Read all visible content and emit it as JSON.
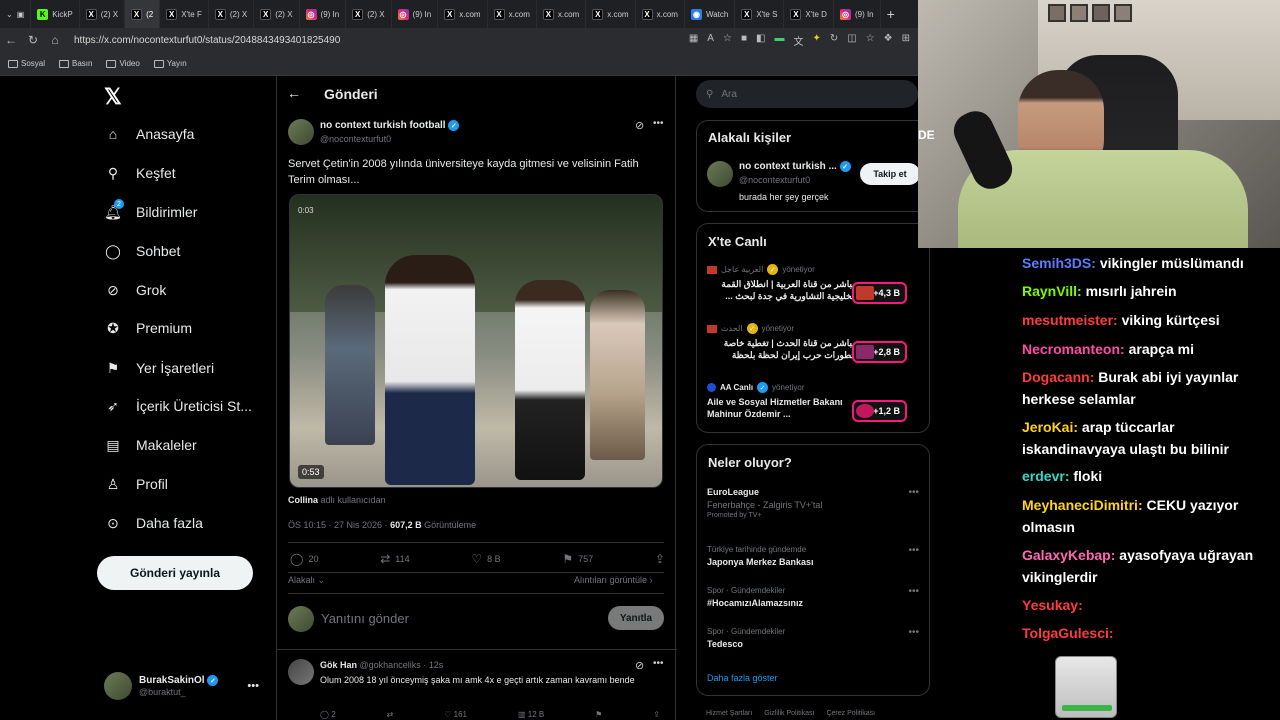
{
  "browser": {
    "tabs": [
      {
        "icon": "kick",
        "label": "KickP"
      },
      {
        "icon": "x",
        "label": "(2) X"
      },
      {
        "icon": "x",
        "label": "(2"
      },
      {
        "icon": "x",
        "label": "X'te F"
      },
      {
        "icon": "x",
        "label": "(2) X"
      },
      {
        "icon": "x",
        "label": "(2) X"
      },
      {
        "icon": "ig",
        "label": "(9) In"
      },
      {
        "icon": "x",
        "label": "(2) X"
      },
      {
        "icon": "ig",
        "label": "(9) In"
      },
      {
        "icon": "x",
        "label": "x.com"
      },
      {
        "icon": "x",
        "label": "x.com"
      },
      {
        "icon": "x",
        "label": "x.com"
      },
      {
        "icon": "x",
        "label": "x.com"
      },
      {
        "icon": "x",
        "label": "x.com"
      },
      {
        "icon": "w",
        "label": "Watch"
      },
      {
        "icon": "x",
        "label": "X'te S"
      },
      {
        "icon": "x",
        "label": "X'te D"
      },
      {
        "icon": "ig",
        "label": "(9) In"
      }
    ],
    "url": "https://x.com/nocontexturfut0/status/2048843493401825490",
    "bookmarks": [
      "Sosyal",
      "Basın",
      "Video",
      "Yayın"
    ]
  },
  "nav": {
    "items": [
      "Anasayfa",
      "Keşfet",
      "Bildirimler",
      "Sohbet",
      "Grok",
      "Premium",
      "Yer İşaretleri",
      "İçerik Üreticisi St...",
      "Makaleler",
      "Profil",
      "Daha fazla"
    ],
    "notif_count": "2",
    "post_button": "Gönderi yayınla",
    "account_name": "BurakSakinOl",
    "account_handle": "@buraktut_"
  },
  "post": {
    "header": "Gönderi",
    "author": "no context turkish football",
    "handle": "@nocontexturfut0",
    "text": "Servet Çetin'in 2008 yılında üniversiteye kayda gitmesi ve velisinin Fatih Terim olması...",
    "video_time_top": "0:03",
    "video_duration": "0:53",
    "credit_name": "Collina",
    "credit_suffix": "adlı kullanıcıdan",
    "timestamp": "ÖS 10:15 · 27 Nis 2026 ·",
    "views_value": "607,2 B",
    "views_label": "Görüntüleme",
    "replies": "20",
    "reposts": "114",
    "likes": "8 B",
    "bookmarks": "757",
    "related": "Alakalı",
    "quotes_link": "Alıntıları görüntüle",
    "reply_placeholder": "Yanıtını gönder",
    "reply_button": "Yanıtla"
  },
  "reply": {
    "name": "Gök Han",
    "handle": "@gokhanceliks · 12s",
    "text": "Olum 2008 18 yıl önceymiş şaka mı amk 4x e geçti artık zaman kavramı bende",
    "replies": "2",
    "likes": "161",
    "views": "12 B"
  },
  "sidebar": {
    "search_placeholder": "Ara",
    "relevant_title": "Alakalı kişiler",
    "person_name": "no context turkish ...",
    "person_handle": "@nocontexturfut0",
    "person_bio": "burada her şey gerçek",
    "follow_button": "Takip et",
    "live_title": "X'te Canlı",
    "live": [
      {
        "host": "العربية عاجل",
        "status": "yönetiyor",
        "title": "مباشر من قناة العربية | انطلاق القمة الخليجية التشاورية في جدة لبحث ...",
        "count": "+4,3 B"
      },
      {
        "host": "الحدث",
        "status": "yönetiyor",
        "title": "مباشر من قناة الحدث | تغطية خاصة لتطورات حرب إيران لحظة بلحظة",
        "count": "+2,8 B"
      },
      {
        "host": "AA Canlı",
        "status": "yönetiyor",
        "title": "Aile ve Sosyal Hizmetler Bakanı Mahinur Özdemir ...",
        "count": "+1,2 B"
      }
    ],
    "happening_title": "Neler oluyor?",
    "trends": [
      {
        "category": "EuroLeague",
        "name": "Fenerbahçe - Zalgiris TV+'tal",
        "promo": "Promoted by TV+"
      },
      {
        "category": "Türkiye tarihinde gündemde",
        "name": "Japonya Merkez Bankası"
      },
      {
        "category": "Spor · Gündemdekiler",
        "name": "#HocamızıAlamazsınız"
      },
      {
        "category": "Spor · Gündemdekiler",
        "name": "Tedesco"
      }
    ],
    "show_more": "Daha fazla göster",
    "footer": [
      "Hizmet Şartları",
      "Gizlilik Politikası",
      "Çerez Politikası"
    ]
  },
  "chat": [
    {
      "user": "Semih3DS",
      "msg": "vikingler müslümandı",
      "color": "#5b7cff"
    },
    {
      "user": "RaynVill",
      "msg": "mısırlı jahrein",
      "color": "#7cfc00"
    },
    {
      "user": "mesutmeister",
      "msg": "viking kürtçesi",
      "color": "#ff3b3b"
    },
    {
      "user": "Necromanteon",
      "msg": "arapça mi",
      "color": "#ff4da6"
    },
    {
      "user": "Dogacann",
      "msg": "Burak abi iyi yayınlar herkese selamlar",
      "color": "#ff3b3b"
    },
    {
      "user": "JeroKai",
      "msg": "arap tüccarlar iskandinavyaya ulaştı bu bilinir",
      "color": "#ffd21f"
    },
    {
      "user": "erdevr",
      "msg": "floki",
      "color": "#3ad6c8"
    },
    {
      "user": "MeyhaneciDimitri",
      "msg": "CEKU yazıyor olmasın",
      "color": "#ffd21f"
    },
    {
      "user": "GalaxyKebap",
      "msg": "ayasofyaya uğrayan vikinglerdir",
      "color": "#ff69b4"
    },
    {
      "user": "Yesukay",
      "msg": "",
      "color": "#ff3b3b"
    },
    {
      "user": "TolgaGulesci",
      "msg": "",
      "color": "#ff3b3b"
    }
  ],
  "colors": {
    "accent": "#1d9bf0",
    "live": "#f91880"
  }
}
